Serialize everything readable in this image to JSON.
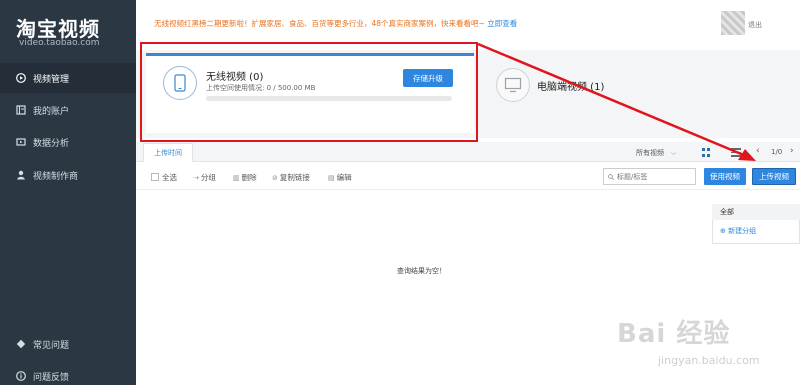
{
  "sidebar": {
    "logo_title": "淘宝视频",
    "logo_sub": "video.taobao.com",
    "items": [
      {
        "label": "视频管理",
        "icon": "video-play-icon"
      },
      {
        "label": "我的账户",
        "icon": "account-book-icon"
      },
      {
        "label": "数据分析",
        "icon": "analytics-icon"
      },
      {
        "label": "视频制作商",
        "icon": "person-icon"
      }
    ],
    "bottom_items": [
      {
        "label": "常见问题",
        "icon": "diamond-icon"
      },
      {
        "label": "问题反馈",
        "icon": "info-circle-icon"
      }
    ]
  },
  "header": {
    "notice": "无线视频红黑榜二期更新啦！扩展家居、食品、百货等更多行业，48个真实商家案例，快来看看吧~ ",
    "notice_link": "立即查看",
    "logout": "退出"
  },
  "wireless": {
    "title": "无线视频 (0)",
    "usage": "上传空间使用情况: 0 / 500.00 MB",
    "usage_fraction": 0,
    "upgrade_button": "存储升级"
  },
  "pc": {
    "title": "电脑端视频 (1)"
  },
  "tabs": {
    "upload_time": "上传时间"
  },
  "filter": {
    "selected": "所有视频"
  },
  "pager": {
    "text": "1/0",
    "prev": "‹",
    "next": "›"
  },
  "toolbar": {
    "select_all": "全选",
    "group": "分组",
    "delete": "删除",
    "copy_link": "复制链接",
    "edit": "编辑"
  },
  "search": {
    "placeholder": "标题/标签"
  },
  "buttons": {
    "use_video": "使用视频",
    "upload_video": "上传视频"
  },
  "groups": {
    "header": "全部",
    "new_group": "⊕ 新建分组"
  },
  "main": {
    "empty_message": "查询结果为空！"
  },
  "watermark": {
    "main": "Bai 经验",
    "sub": "jingyan.baidu.com"
  },
  "colors": {
    "sidebar_bg": "#2b3844",
    "accent_blue": "#2e86de",
    "annotation_red": "#e0151e",
    "notice_orange": "#e8711c"
  }
}
